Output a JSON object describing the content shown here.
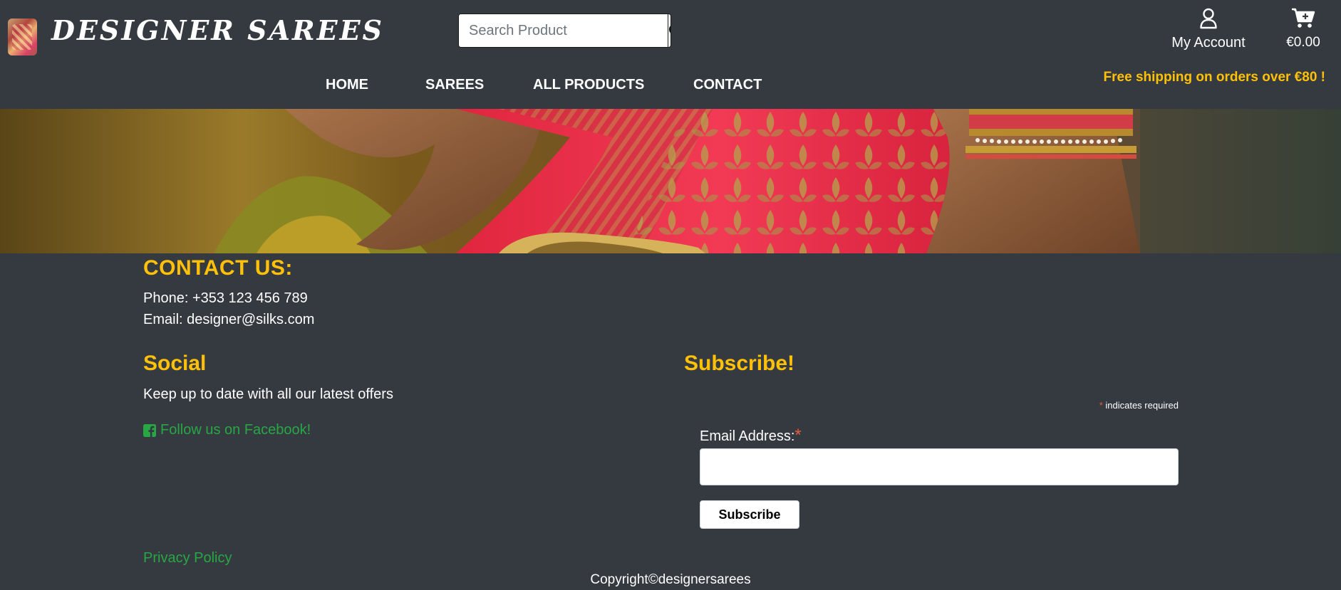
{
  "header": {
    "brand": "DESIGNER SAREES",
    "search": {
      "placeholder": "Search Product",
      "value": ""
    },
    "account_label": "My Account",
    "cart_total": "€0.00",
    "nav": [
      {
        "label": "HOME"
      },
      {
        "label": "SAREES"
      },
      {
        "label": "ALL PRODUCTS"
      },
      {
        "label": "CONTACT"
      }
    ],
    "shipping_banner": "Free shipping on orders over €80 !"
  },
  "contact": {
    "title": "CONTACT US:",
    "phone": "Phone: +353 123 456 789",
    "email": "Email: designer@silks.com"
  },
  "social": {
    "title": "Social",
    "text": "Keep up to date with all our latest offers",
    "facebook_link": "Follow us on Facebook!"
  },
  "subscribe": {
    "title": "Subscribe!",
    "required_star": "*",
    "required_note": "indicates required",
    "email_label": "Email Address:",
    "email_value": "",
    "button_label": "Subscribe"
  },
  "footer": {
    "privacy": "Privacy Policy",
    "copyright": "Copyright©designersarees"
  },
  "colors": {
    "background": "#343a40",
    "accent": "#ffc107",
    "link": "#28a745",
    "required": "#e85c41"
  },
  "icons": [
    "search-icon",
    "user-icon",
    "cart-icon",
    "facebook-icon"
  ]
}
